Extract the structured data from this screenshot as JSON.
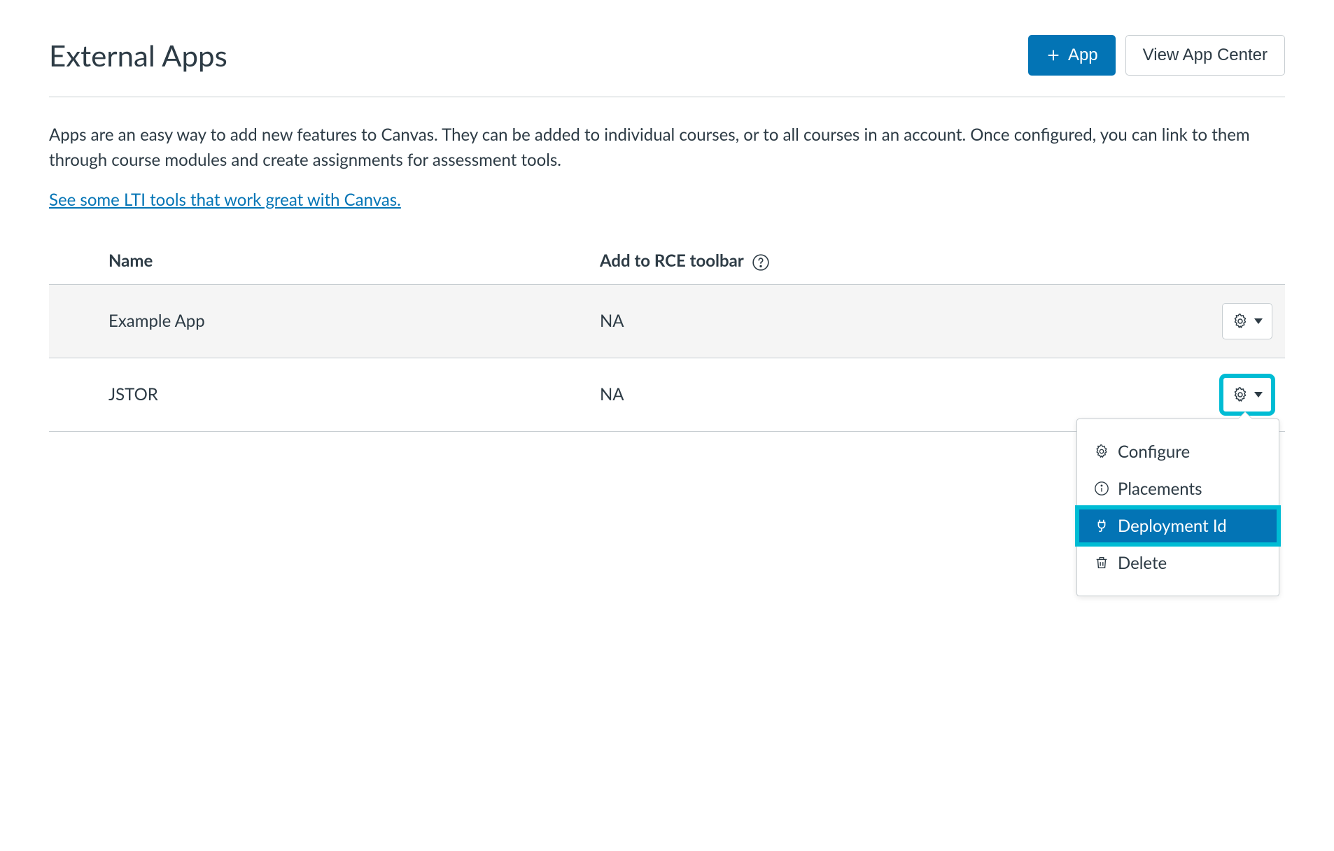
{
  "header": {
    "title": "External Apps",
    "add_button_label": "App",
    "view_app_center_label": "View App Center"
  },
  "description": "Apps are an easy way to add new features to Canvas. They can be added to individual courses, or to all courses in an account. Once configured, you can link to them through course modules and create assignments for assessment tools.",
  "lti_link_text": "See some LTI tools that work great with Canvas.",
  "table": {
    "columns": {
      "name": "Name",
      "rce": "Add to RCE toolbar"
    },
    "rows": [
      {
        "name": "Example App",
        "rce": "NA"
      },
      {
        "name": "JSTOR",
        "rce": "NA"
      }
    ]
  },
  "dropdown": {
    "configure": "Configure",
    "placements": "Placements",
    "deployment_id": "Deployment Id",
    "delete": "Delete"
  }
}
